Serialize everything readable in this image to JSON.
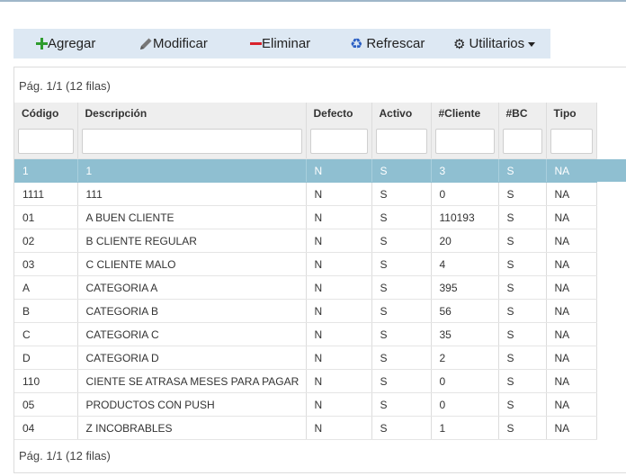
{
  "toolbar": {
    "add_label": "Agregar",
    "modify_label": "Modificar",
    "delete_label": "Eliminar",
    "refresh_label": "Refrescar",
    "utilities_label": "Utilitarios"
  },
  "pager": {
    "top": "Pág. 1/1 (12 filas)",
    "bottom": "Pág. 1/1 (12 filas)"
  },
  "table": {
    "columns": [
      "Código",
      "Descripción",
      "Defecto",
      "Activo",
      "#Cliente",
      "#BC",
      "Tipo"
    ],
    "selected_index": 0,
    "rows": [
      [
        "1",
        "1",
        "N",
        "S",
        "3",
        "S",
        "NA"
      ],
      [
        "1111",
        "111",
        "N",
        "S",
        "0",
        "S",
        "NA"
      ],
      [
        "01",
        "A BUEN CLIENTE",
        "N",
        "S",
        "110193",
        "S",
        "NA"
      ],
      [
        "02",
        "B CLIENTE REGULAR",
        "N",
        "S",
        "20",
        "S",
        "NA"
      ],
      [
        "03",
        "C CLIENTE MALO",
        "N",
        "S",
        "4",
        "S",
        "NA"
      ],
      [
        "A",
        "CATEGORIA A",
        "N",
        "S",
        "395",
        "S",
        "NA"
      ],
      [
        "B",
        "CATEGORIA B",
        "N",
        "S",
        "56",
        "S",
        "NA"
      ],
      [
        "C",
        "CATEGORIA C",
        "N",
        "S",
        "35",
        "S",
        "NA"
      ],
      [
        "D",
        "CATEGORIA D",
        "N",
        "S",
        "2",
        "S",
        "NA"
      ],
      [
        "110",
        "CIENTE SE ATRASA MESES PARA PAGAR",
        "N",
        "S",
        "0",
        "S",
        "NA"
      ],
      [
        "05",
        "PRODUCTOS CON PUSH",
        "N",
        "S",
        "0",
        "S",
        "NA"
      ],
      [
        "04",
        "Z INCOBRABLES",
        "N",
        "S",
        "1",
        "S",
        "NA"
      ]
    ]
  },
  "colors": {
    "toolbar_bg": "#dde8f3",
    "selected_row": "#8fbfd1",
    "add_icon": "#2e9c2e",
    "delete_icon": "#d9232d",
    "refresh_icon": "#2a5fc4"
  },
  "icons": [
    "plus-icon",
    "pencil-icon",
    "minus-icon",
    "recycle-icon",
    "gears-icon",
    "caret-down-icon"
  ]
}
